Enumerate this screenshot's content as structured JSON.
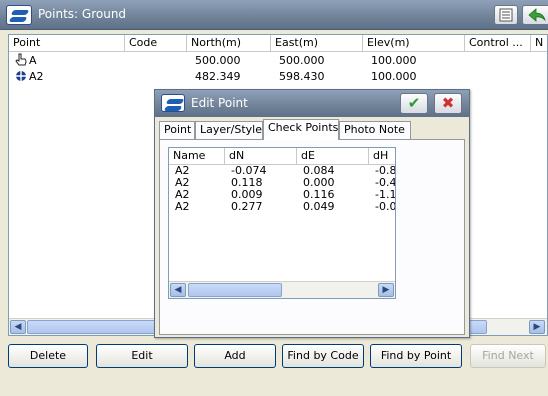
{
  "window": {
    "title": "Points: Ground"
  },
  "columns": [
    "Point",
    "Code",
    "North(m)",
    "East(m)",
    "Elev(m)",
    "Control ...",
    "N"
  ],
  "rows": [
    {
      "point": "A",
      "code": "",
      "north": "500.000",
      "east": "500.000",
      "elev": "100.000",
      "icon": "hand-pointer-icon"
    },
    {
      "point": "A2",
      "code": "",
      "north": "482.349",
      "east": "598.430",
      "elev": "100.000",
      "icon": "check-point-icon"
    }
  ],
  "buttons": {
    "delete": "Delete",
    "edit": "Edit",
    "add": "Add",
    "find_by_code": "Find by Code",
    "find_by_point": "Find by Point",
    "find_next": "Find Next"
  },
  "dialog": {
    "title": "Edit Point",
    "tabs": [
      "Point",
      "Layer/Style",
      "Check Points",
      "Photo Note"
    ],
    "active_tab": "Check Points",
    "columns": [
      "Name",
      "dN",
      "dE",
      "dH"
    ],
    "rows": [
      {
        "name": "A2",
        "dN": "-0.074",
        "dE": "0.084",
        "dH": "-0.8"
      },
      {
        "name": "A2",
        "dN": "0.118",
        "dE": "0.000",
        "dH": "-0.4"
      },
      {
        "name": "A2",
        "dN": "0.009",
        "dE": "0.116",
        "dH": "-1.1"
      },
      {
        "name": "A2",
        "dN": "0.277",
        "dE": "0.049",
        "dH": "-0.0"
      }
    ]
  }
}
